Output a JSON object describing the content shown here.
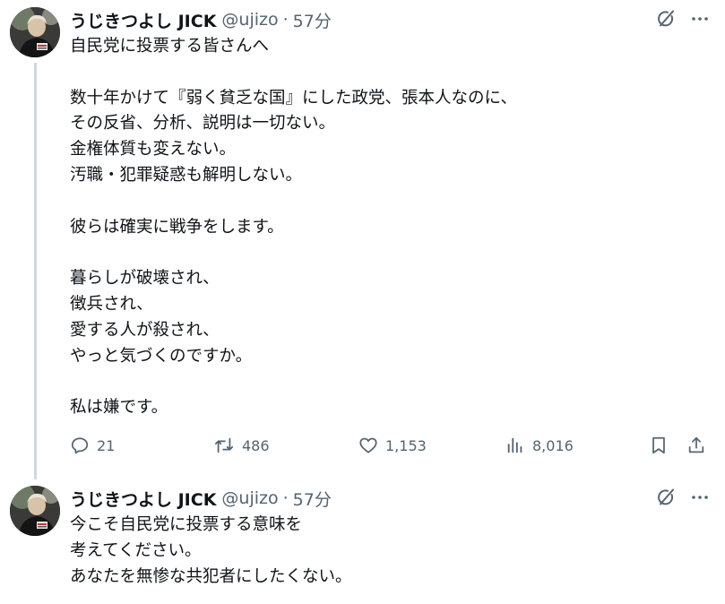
{
  "tweets": [
    {
      "author": {
        "name": "うじきつよし JICK",
        "handle": "@ujizo"
      },
      "separator": "·",
      "time": "57分",
      "lines": [
        "自民党に投票する皆さんへ",
        "",
        "数十年かけて『弱く貧乏な国』にした政党、張本人なのに、",
        "その反省、分析、説明は一切ない。",
        "金権体質も変えない。",
        "汚職・犯罪疑惑も解明しない。",
        "",
        "彼らは確実に戦争をします。",
        "",
        "暮らしが破壊され、",
        "徴兵され、",
        "愛する人が殺され、",
        "やっと気づくのですか。",
        "",
        "私は嫌です。"
      ],
      "stats": {
        "replies": "21",
        "reposts": "486",
        "likes": "1,153",
        "views": "8,016"
      }
    },
    {
      "author": {
        "name": "うじきつよし JICK",
        "handle": "@ujizo"
      },
      "separator": "·",
      "time": "57分",
      "lines": [
        "今こそ自民党に投票する意味を",
        "考えてください。",
        "あなたを無惨な共犯者にしたくない。"
      ]
    }
  ],
  "icons": {
    "grok": "grok-icon",
    "more": "more-icon",
    "reply": "reply-icon",
    "repost": "repost-icon",
    "like": "like-icon",
    "views": "views-icon",
    "bookmark": "bookmark-icon",
    "share": "share-icon"
  }
}
